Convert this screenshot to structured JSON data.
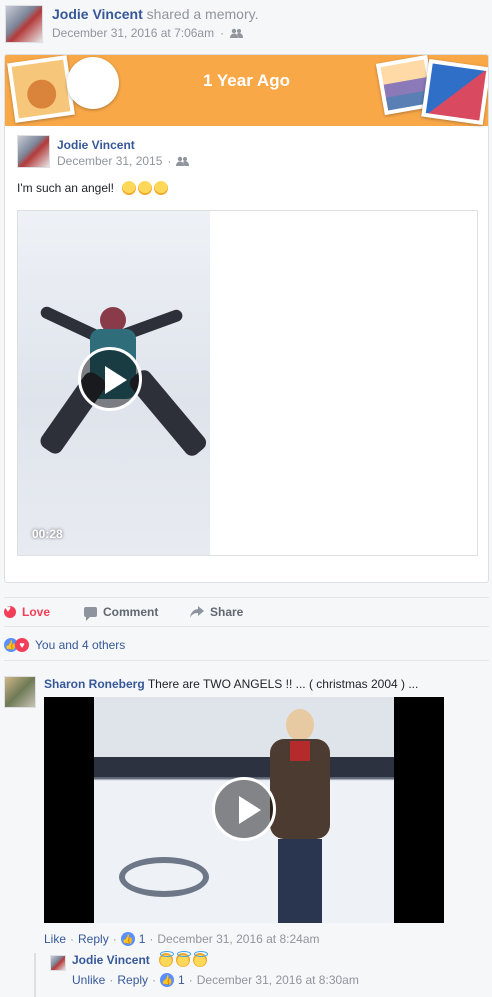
{
  "header": {
    "author": "Jodie Vincent",
    "action": "shared a memory.",
    "timestamp": "December 31, 2016 at 7:06am",
    "audience_icon": "friends-icon"
  },
  "memory": {
    "banner_title": "1 Year Ago",
    "banner_color": "#f9a848",
    "post": {
      "author": "Jodie Vincent",
      "date": "December 31, 2015",
      "text": "I'm such an angel!",
      "emojis": [
        "laughing-emoji",
        "laughing-emoji",
        "laughing-emoji"
      ],
      "video": {
        "duration": "00:28"
      }
    }
  },
  "actions": {
    "love": "Love",
    "comment": "Comment",
    "share": "Share"
  },
  "reactions": {
    "summary": "You and 4 others"
  },
  "comments": [
    {
      "author": "Sharon Roneberg",
      "text": "There are TWO ANGELS !! ... ( christmas 2004 ) ...",
      "like": "Like",
      "reply": "Reply",
      "like_count": "1",
      "timestamp": "December 31, 2016 at 8:24am",
      "replies": [
        {
          "author": "Jodie Vincent",
          "emojis": [
            "smiling-halo-emoji",
            "smiling-halo-emoji",
            "smiling-halo-emoji"
          ],
          "unlike": "Unlike",
          "reply": "Reply",
          "like_count": "1",
          "timestamp": "December 31, 2016 at 8:30am"
        }
      ]
    }
  ],
  "colors": {
    "link": "#365899",
    "love": "#f33e58",
    "like": "#5890ff"
  }
}
